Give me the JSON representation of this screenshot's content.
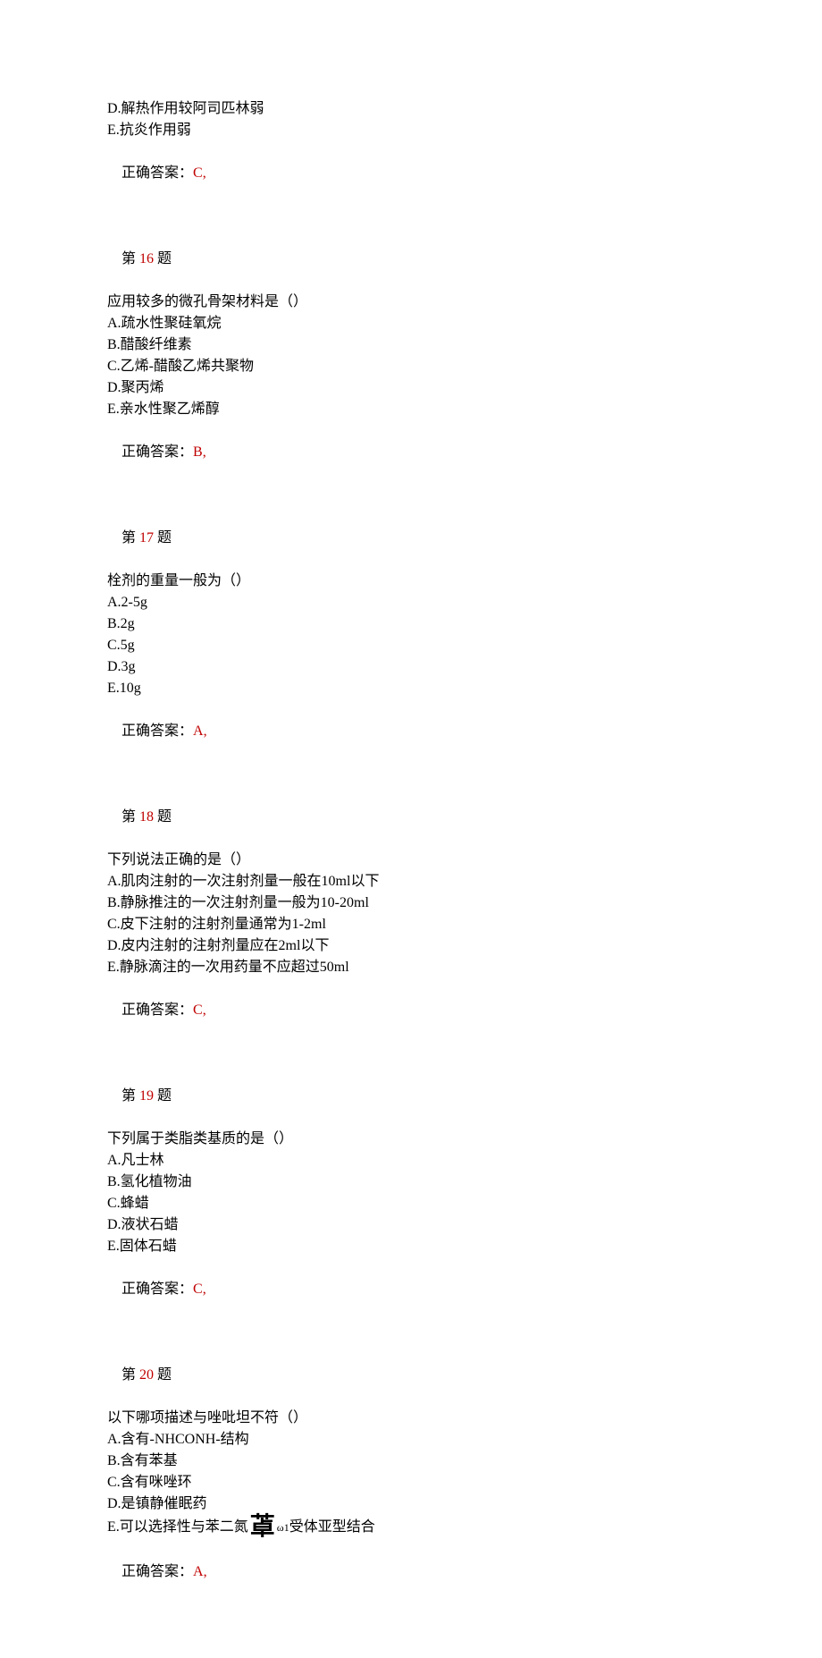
{
  "cont": {
    "d": "D.解热作用较阿司匹林弱",
    "e": "E.抗炎作用弱",
    "ans_label": "正确答案：",
    "ans_value": "C,"
  },
  "q16": {
    "prefix": "第 ",
    "num": "16",
    "suffix": " 题",
    "stem": "应用较多的微孔骨架材料是（）",
    "a": "A.疏水性聚硅氧烷",
    "b": "B.醋酸纤维素",
    "c": "C.乙烯-醋酸乙烯共聚物",
    "d": "D.聚丙烯",
    "e": "E.亲水性聚乙烯醇",
    "ans_label": "正确答案：",
    "ans_value": "B,"
  },
  "q17": {
    "prefix": "第 ",
    "num": "17",
    "suffix": " 题",
    "stem": "栓剂的重量一般为（）",
    "a": "A.2-5g",
    "b": "B.2g",
    "c": "C.5g",
    "d": "D.3g",
    "e": "E.10g",
    "ans_label": "正确答案：",
    "ans_value": "A,"
  },
  "q18": {
    "prefix": "第 ",
    "num": "18",
    "suffix": " 题",
    "stem": "下列说法正确的是（）",
    "a": "A.肌肉注射的一次注射剂量一般在10ml以下",
    "b": "B.静脉推注的一次注射剂量一般为10-20ml",
    "c": "C.皮下注射的注射剂量通常为1-2ml",
    "d": "D.皮内注射的注射剂量应在2ml以下",
    "e": "E.静脉滴注的一次用药量不应超过50ml",
    "ans_label": "正确答案：",
    "ans_value": "C,"
  },
  "q19": {
    "prefix": "第 ",
    "num": "19",
    "suffix": " 题",
    "stem": "下列属于类脂类基质的是（）",
    "a": "A.凡士林",
    "b": "B.氢化植物油",
    "c": "C.蜂蜡",
    "d": "D.液状石蜡",
    "e": "E.固体石蜡",
    "ans_label": "正确答案：",
    "ans_value": "C,"
  },
  "q20": {
    "prefix": "第 ",
    "num": "20",
    "suffix": " 题",
    "stem": "以下哪项描述与唑吡坦不符（）",
    "a": "A.含有-NHCONH-结构",
    "b": "B.含有苯基",
    "c": "C.含有咪唑环",
    "d": "D.是镇静催眠药",
    "e_pre": "E.可以选择性与苯二氮",
    "e_glyph": "䓬",
    "e_sub": "ω1",
    "e_post": "受体亚型结合",
    "ans_label": "正确答案：",
    "ans_value": "A,"
  }
}
